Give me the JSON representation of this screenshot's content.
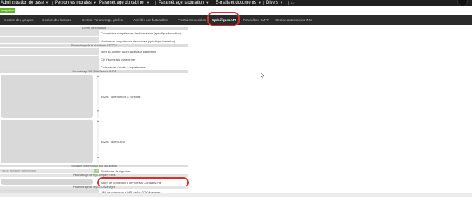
{
  "menubar": {
    "items": [
      {
        "label": "Administration de base"
      },
      {
        "label": "Personnes morales"
      },
      {
        "label": "Paramétrage du cabinet"
      },
      {
        "label": "Paramétrage facturation"
      },
      {
        "label": "E-mails et documents"
      },
      {
        "label": "Divers"
      },
      {
        "label": "BC"
      }
    ]
  },
  "green_button": {
    "label": "Intégration"
  },
  "tabs": [
    {
      "label": "Gestion des groupes"
    },
    {
      "label": "Gestion des factures"
    },
    {
      "label": "Gestion Paramétrage général"
    },
    {
      "label": "Activités non facturables"
    },
    {
      "label": "Prestations sociales"
    },
    {
      "label": "Spécifiques API"
    },
    {
      "label": "Paramètres SMTP"
    },
    {
      "label": "Gestion autorisations INM"
    }
  ],
  "sections": {
    "formation": "Centre de formation",
    "edoc": "Paramétrage de la plateforme EDOC®",
    "web_service": "Paramétrage WF Web Service IBIZA",
    "signature": "Signature électronique des documents",
    "company": "Paramétrage de My Company Files",
    "dgo": "Paramétrage de My DGO Manager"
  },
  "fields": {
    "courriel_competences": "Courriel des compétences des formateurs (spécifique formation)",
    "nombre_competences": "Nombre de compétences disponibles (spécifique formation)",
    "ident_compte": "Ident du compte pour l'accès à la plateforme",
    "cle_acces": "Clé d'accès à la plateforme",
    "code_secret": "Code secret d'accès à la plateforme",
    "ibiza_import": "IBIZA : Token Import à Ecritures",
    "ibiza_crm": "IBIZA : Token CRM",
    "plateforme_signature": "Plateforme de signature",
    "token_company": "Token de connexion à l'API de My Company File",
    "url_dgo": "URL de connexion à l'API de My DGO Manager"
  },
  "signature_input": {
    "placeholder": "Pas de signature électronique"
  },
  "signature_button": {
    "label": "+"
  }
}
